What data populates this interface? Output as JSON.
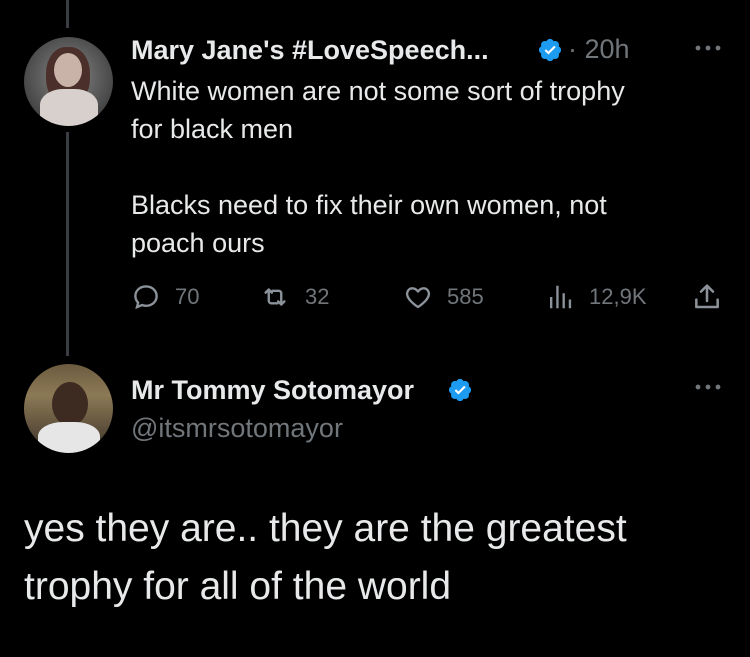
{
  "tweet1": {
    "display_name": "Mary Jane's #LoveSpeech...",
    "separator_time": "· 20h",
    "text_lines": [
      "White women are not some sort of trophy",
      "for black men",
      "Blacks need to fix their own women, not",
      "poach ours"
    ],
    "replies": "70",
    "retweets": "32",
    "likes": "585",
    "views": "12,9K"
  },
  "tweet2": {
    "display_name": "Mr Tommy Sotomayor",
    "handle": "@itsmrsotomayor",
    "text_lines": [
      "yes they are.. they are the greatest",
      "trophy for all of the world"
    ]
  },
  "colors": {
    "background": "#000000",
    "text_primary": "#e7e9ea",
    "text_secondary": "#71767b",
    "verified_blue": "#1d9bf0",
    "thread_line": "#3a3d41"
  },
  "icons": {
    "reply": "speech-bubble-icon",
    "retweet": "retweet-icon",
    "like": "heart-icon",
    "views": "bar-chart-icon",
    "share": "share-icon",
    "verified": "verified-badge-icon",
    "more": "ellipsis-icon"
  }
}
